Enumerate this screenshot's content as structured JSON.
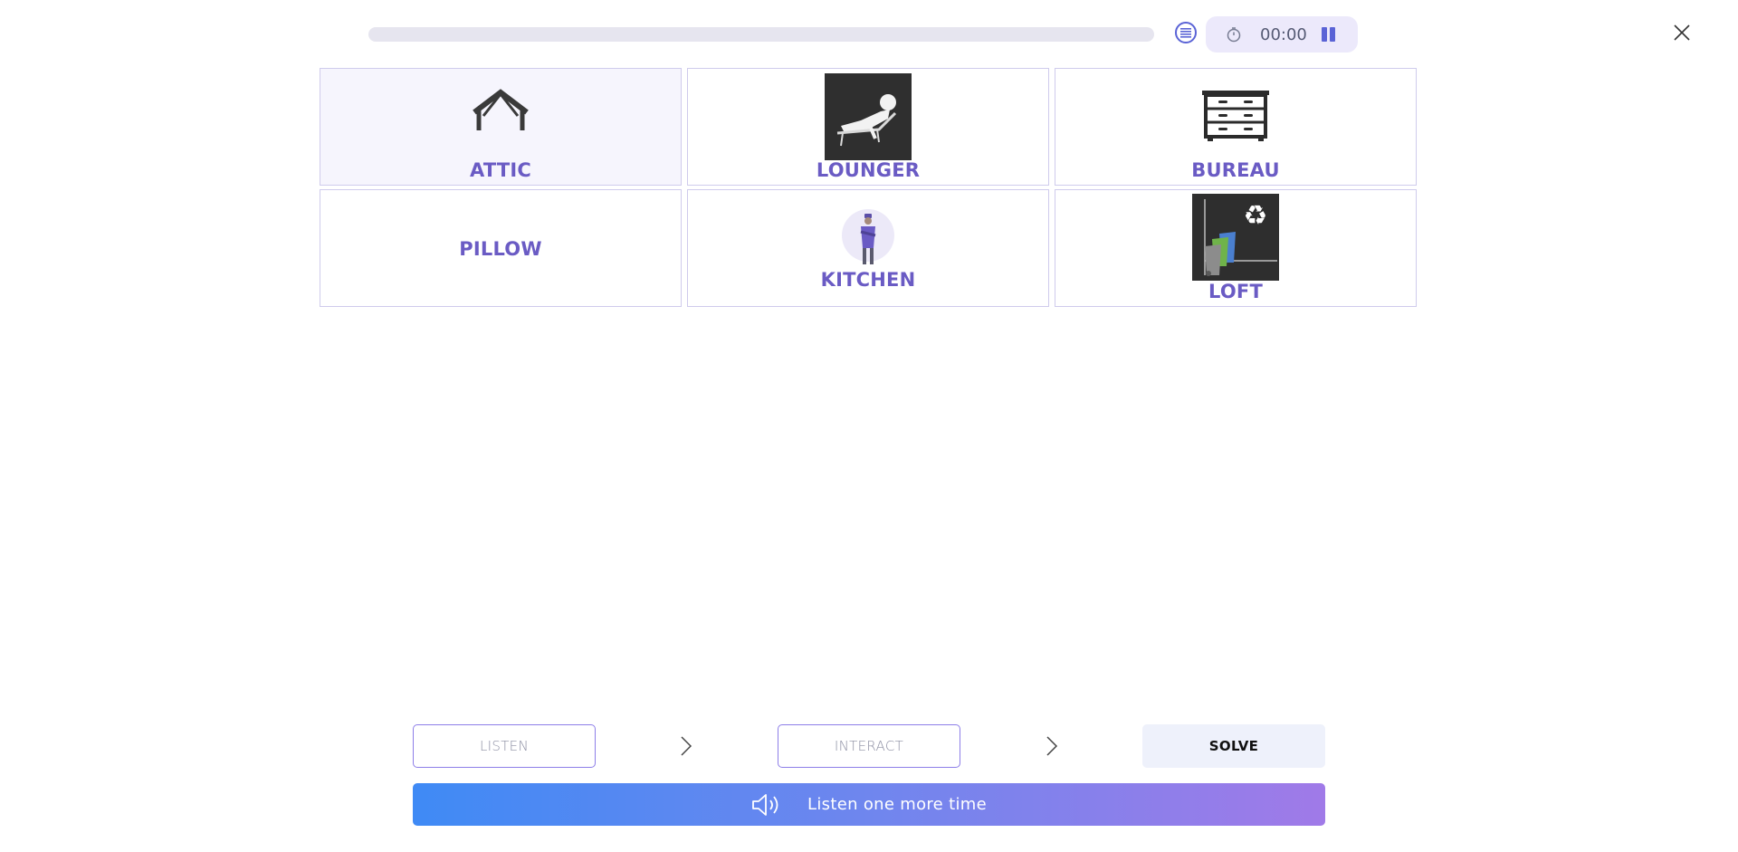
{
  "header": {
    "progress_fraction": 0,
    "timer": "00:00",
    "icons": {
      "list": "list-icon",
      "timer": "stopwatch-icon",
      "pause": "pause-icon",
      "close": "close-icon"
    }
  },
  "cards": [
    {
      "label": "ATTIC",
      "icon": "roof-frame-icon",
      "selected": true
    },
    {
      "label": "LOUNGER",
      "icon": "person-on-lounger-image",
      "selected": false
    },
    {
      "label": "BUREAU",
      "icon": "chest-of-drawers-icon",
      "selected": false
    },
    {
      "label": "PILLOW",
      "icon": "",
      "selected": false
    },
    {
      "label": "KITCHEN",
      "icon": "chef-avatar-image",
      "selected": false
    },
    {
      "label": "LOFT",
      "icon": "recycling-bins-image",
      "selected": false
    }
  ],
  "steps": {
    "listen": "LISTEN",
    "interact": "INTERACT",
    "solve": "SOLVE"
  },
  "listen_again": {
    "label": "Listen one more time",
    "icon": "speaker-icon"
  },
  "colors": {
    "accent": "#6a5bc4",
    "card_border": "#cfcbec",
    "gradient_start": "#3f8af5",
    "gradient_end": "#a07ae8"
  }
}
